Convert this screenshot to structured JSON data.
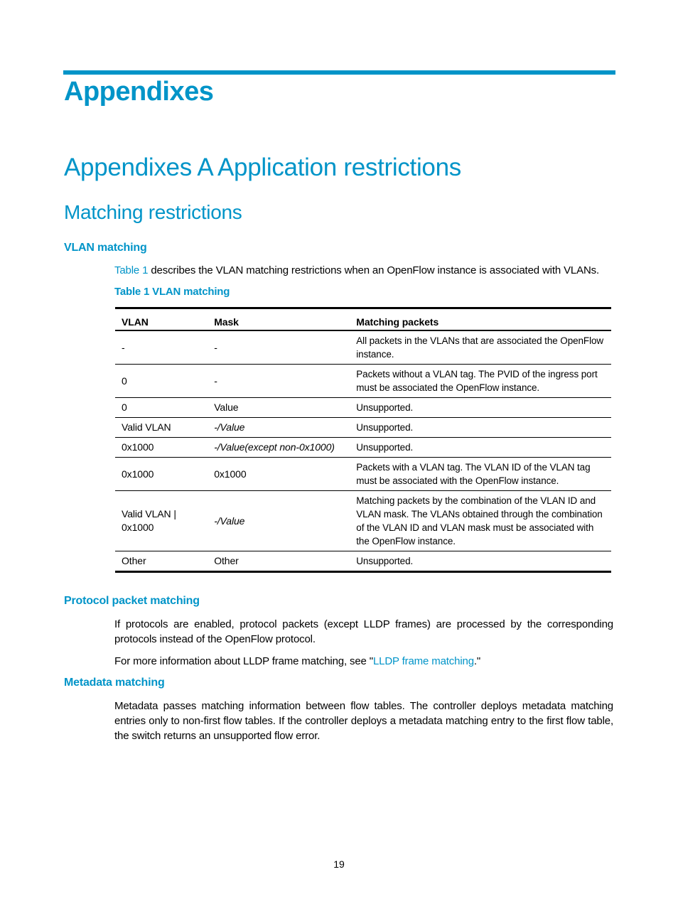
{
  "chapter_title": "Appendixes",
  "section_title": "Appendixes A Application restrictions",
  "subsection_title": "Matching restrictions",
  "vlan_matching": {
    "heading": "VLAN matching",
    "intro_link": "Table 1",
    "intro_text": " describes the VLAN matching restrictions when an OpenFlow instance is associated with VLANs.",
    "table_caption": "Table 1 VLAN matching",
    "table": {
      "headers": [
        "VLAN",
        "Mask",
        "Matching packets"
      ],
      "rows": [
        {
          "vlan": "-",
          "mask": "-",
          "matching": "All packets in the VLANs that are associated the OpenFlow instance."
        },
        {
          "vlan": "0",
          "mask": "-",
          "matching": "Packets without a VLAN tag. The PVID of the ingress port must be associated the OpenFlow instance."
        },
        {
          "vlan": "0",
          "mask": "Value",
          "matching": "Unsupported."
        },
        {
          "vlan": "Valid VLAN",
          "mask": "-/Value",
          "matching": "Unsupported."
        },
        {
          "vlan": "0x1000",
          "mask": "-/Value(except non-0x1000)",
          "matching": "Unsupported."
        },
        {
          "vlan": "0x1000",
          "mask": "0x1000",
          "matching": "Packets with a VLAN tag. The VLAN ID of the VLAN tag must be associated with the OpenFlow instance."
        },
        {
          "vlan": "Valid VLAN | 0x1000",
          "mask": "-/Value",
          "matching": "Matching packets by the combination of the VLAN ID and VLAN mask. The VLANs obtained through the combination of the VLAN ID and VLAN mask must be associated with the OpenFlow instance."
        },
        {
          "vlan": "Other",
          "mask": "Other",
          "matching": "Unsupported."
        }
      ]
    }
  },
  "protocol_packet_matching": {
    "heading": "Protocol packet matching",
    "para1": "If protocols are enabled, protocol packets (except LLDP frames) are processed by the corresponding protocols instead of the OpenFlow protocol.",
    "para2_prefix": "For more information about LLDP frame matching, see \"",
    "para2_link": "LLDP frame matching",
    "para2_suffix": ".\""
  },
  "metadata_matching": {
    "heading": "Metadata matching",
    "para": "Metadata passes matching information between flow tables. The controller deploys metadata matching entries only to non-first flow tables. If the controller deploys a metadata matching entry to the first flow table, the switch returns an unsupported flow error."
  },
  "page_number": "19",
  "colors": {
    "accent": "#0094c8",
    "text": "#000000"
  }
}
